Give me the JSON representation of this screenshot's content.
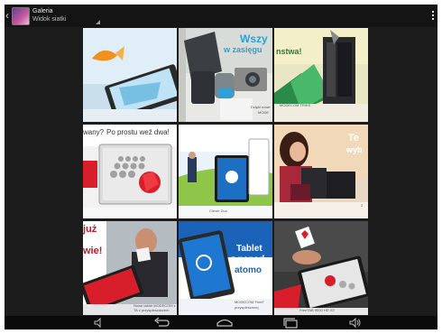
{
  "app": {
    "title": "Galeria",
    "view_mode": "Widok siatki",
    "icon": "gallery-app-icon"
  },
  "actionbar": {
    "back_icon": "chevron-left-icon",
    "overflow_icon": "overflow-menu-icon"
  },
  "tiles": [
    {
      "name": "photo-1",
      "caption": ""
    },
    {
      "name": "photo-2",
      "caption": "Dzięki nowe",
      "caption2": "MODE",
      "caption3": "MODECOM TRIKS",
      "headline": "Wszy",
      "subheadline": "w zasięgu"
    },
    {
      "name": "photo-3",
      "caption": "",
      "headline": "nstwa!"
    },
    {
      "name": "photo-4",
      "headline": "wany?",
      "subheadline": "Po prostu weź dwa!"
    },
    {
      "name": "photo-5",
      "caption": "Clever Duo"
    },
    {
      "name": "photo-6",
      "headline": "Te",
      "subheadline": "wyb",
      "footer": "2"
    },
    {
      "name": "photo-7",
      "headline": "już",
      "subheadline": "wie!",
      "caption": "Nowe tablet MODECOM z",
      "caption2": "TA z przyspieszaczem"
    },
    {
      "name": "photo-8",
      "headline": "Tablet",
      "subheadline": "z napęd",
      "line3": "atomo",
      "caption": "MODECOM FreeT",
      "caption2": "przyspieszonej"
    },
    {
      "name": "photo-9",
      "caption": "FreeTAB 9000 HD X2"
    }
  ],
  "navbar": {
    "volume_down_icon": "volume-down-icon",
    "back_icon": "back-arrow-icon",
    "home_icon": "home-icon",
    "recents_icon": "recent-apps-icon",
    "volume_up_icon": "volume-up-icon"
  }
}
